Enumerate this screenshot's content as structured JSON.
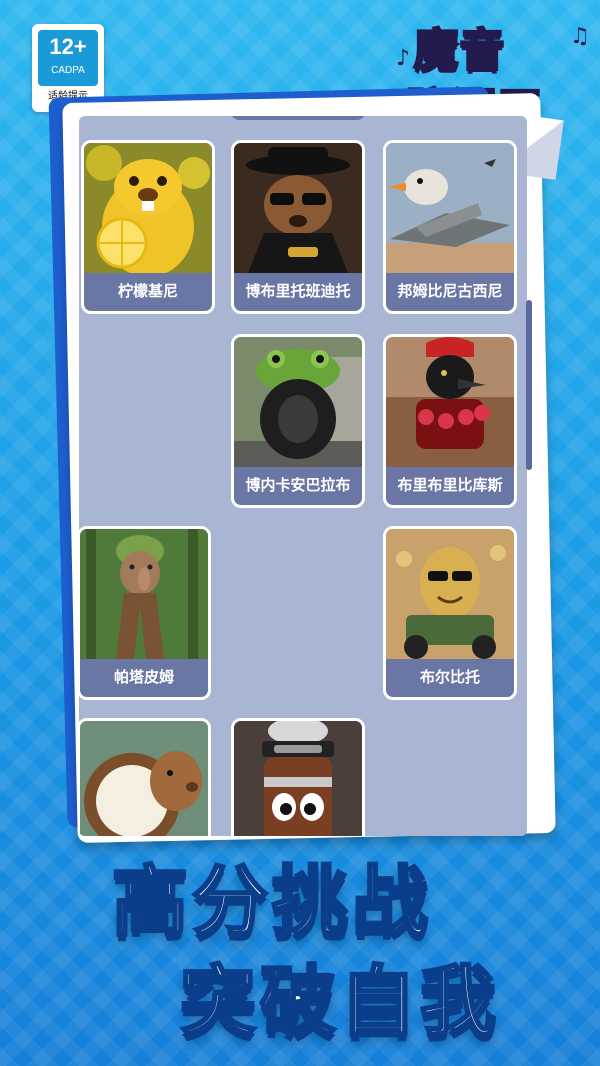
{
  "badge": {
    "age": "12+",
    "org": "CADPA",
    "tip": "适龄提示"
  },
  "logo": {
    "line1": "魔音",
    "line2": "脑洞王"
  },
  "grid": [
    {
      "label": "柠檬基尼",
      "icon": "lemon-beaver"
    },
    {
      "label": "博布里托班迪托",
      "icon": "gangster-beaver"
    },
    {
      "label": "邦姆比尼古西尼",
      "icon": "goose-jet"
    },
    {
      "label": "",
      "icon": "empty-slot"
    },
    {
      "label": "博内卡安巴拉布",
      "icon": "frog-tire"
    },
    {
      "label": "布里布里比库斯",
      "icon": "gladiator-crow"
    },
    {
      "label": "帕塔皮姆",
      "icon": "tree-creature"
    },
    {
      "label": "",
      "icon": "empty-slot"
    },
    {
      "label": "布尔比托",
      "icon": "potato-tractor"
    },
    {
      "label": "",
      "icon": "coconut-capybara"
    },
    {
      "label": "",
      "icon": "coffee-ninja"
    }
  ],
  "headline": {
    "line1": "高分挑战",
    "line2": "突破自我"
  }
}
